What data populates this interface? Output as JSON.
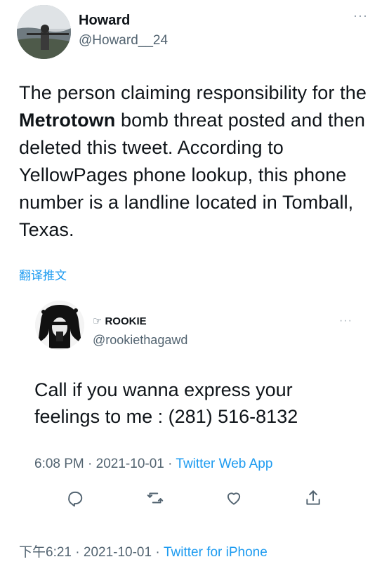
{
  "author": {
    "name": "Howard",
    "handle": "@Howard__24",
    "more": "···"
  },
  "tweet": {
    "text_before": "The person claiming responsibility for the ",
    "text_bold": "Metrotown",
    "text_after": " bomb threat posted and then deleted this tweet. According to YellowPages phone lookup, this phone number is a landline located in Tomball, Texas.",
    "translate_label": "翻译推文"
  },
  "quoted": {
    "name_icon": "☞",
    "name": "ROOKIE",
    "handle": "@rookiethagawd",
    "more": "···",
    "text": "Call if you wanna express your feelings to me : (281) 516-8132",
    "time": "6:08 PM",
    "sep1": " · ",
    "date": "2021-10-01",
    "sep2": " · ",
    "source": "Twitter Web App",
    "actions": [
      "reply-icon",
      "retweet-icon",
      "like-icon",
      "share-icon"
    ]
  },
  "footer": {
    "time": "下午6:21",
    "sep1": " · ",
    "date": "2021-10-01",
    "sep2": " · ",
    "source": "Twitter for iPhone"
  },
  "colors": {
    "link": "#1d9bf0",
    "secondary_text": "#536471",
    "primary_text": "#0f1419"
  }
}
